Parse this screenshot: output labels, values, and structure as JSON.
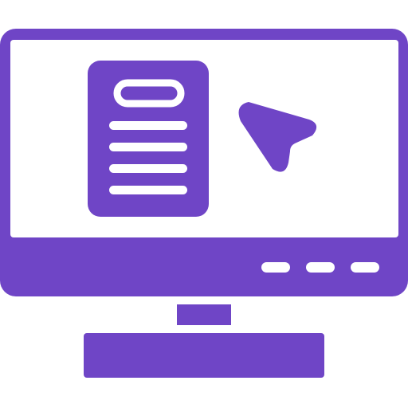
{
  "icon": {
    "name": "computer-monitor-document-cursor-icon",
    "parts": [
      "monitor-icon",
      "document-icon",
      "cursor-arrow-icon",
      "indicator-dots"
    ]
  },
  "colors": {
    "primary": "#6f45c6",
    "screen": "#ffffff",
    "background": "#ffffff"
  },
  "document": {
    "text_line_count": 4
  },
  "bezel": {
    "indicator_count": 3
  }
}
